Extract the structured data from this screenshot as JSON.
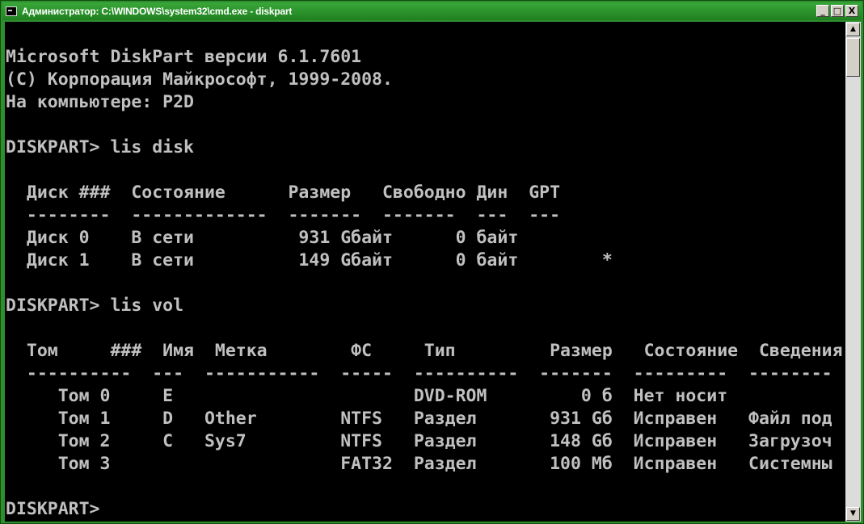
{
  "window": {
    "title": "Администратор: C:\\WINDOWS\\system32\\cmd.exe - diskpart",
    "minimize_glyph": "_",
    "maximize_glyph": "□",
    "close_glyph": "X",
    "icon": "cmd-icon"
  },
  "console": {
    "lines": [
      "Microsoft DiskPart версии 6.1.7601",
      "(C) Корпорация Майкрософт, 1999-2008.",
      "На компьютере: P2D",
      "",
      "DISKPART> lis disk",
      "",
      "  Диск ###  Состояние      Размер   Свободно Дин  GPT",
      "  --------  -------------  -------  -------  ---  ---",
      "  Диск 0    В сети          931 Gбайт      0 байт",
      "  Диск 1    В сети          149 Gбайт      0 байт        *",
      "",
      "DISKPART> lis vol",
      "",
      "  Том     ###  Имя  Метка        ФС     Тип         Размер   Состояние  Сведения",
      "  ----------  ---  -----------  -----  ----------  -------  ---------  --------",
      "     Том 0     E                       DVD-ROM         0 б  Нет носит",
      "     Том 1     D   Other        NTFS   Раздел       931 Gб  Исправен   Файл под",
      "     Том 2     C   Sys7         NTFS   Раздел       148 Gб  Исправен   Загрузоч",
      "     Том 3                      FAT32  Раздел       100 Мб  Исправен   Системны",
      "",
      "DISKPART>"
    ]
  },
  "scrollbar": {
    "up_glyph": "▲",
    "down_glyph": "▼"
  }
}
